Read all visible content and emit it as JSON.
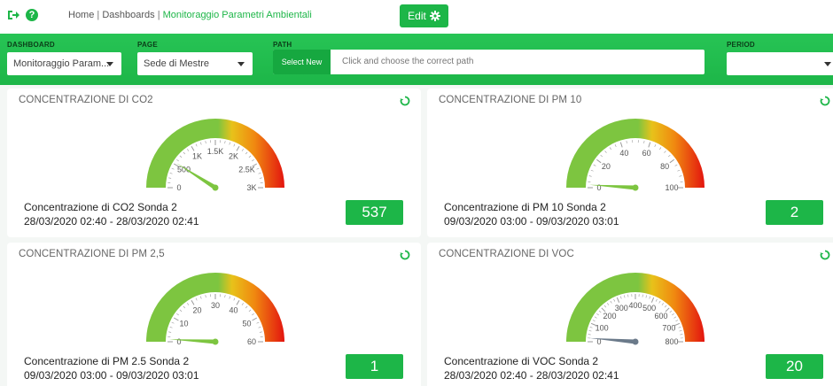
{
  "header": {
    "breadcrumb": {
      "home": "Home",
      "sep1": " | ",
      "dashboards": "Dashboards",
      "sep2": " | ",
      "current": "Monitoraggio Parametri Ambientali"
    },
    "edit_label": "Edit",
    "help_glyph": "?",
    "icons": {
      "logout": "logout-icon",
      "help": "help-icon",
      "gear": "gear-icon"
    }
  },
  "filters": {
    "dashboard": {
      "label": "DASHBOARD",
      "value": "Monitoraggio Param..."
    },
    "page": {
      "label": "PAGE",
      "value": "Sede di Mestre"
    },
    "path": {
      "label": "PATH",
      "button": "Select New",
      "placeholder": "Click and choose the correct path"
    },
    "period": {
      "label": "PERIOD",
      "value": ""
    }
  },
  "colors": {
    "accent": "#1db648",
    "gauge_green": "#7dc540",
    "gauge_yellow": "#f5b400",
    "gauge_red": "#e3140f"
  },
  "cards": [
    {
      "title": "CONCENTRAZIONE DI CO2",
      "desc_line1": "Concentrazione di CO2 Sonda 2",
      "desc_line2": "28/03/2020 02:40 - 28/03/2020 02:41",
      "value": "537",
      "min": 0,
      "max": 3000,
      "reading": 537,
      "ticks": [
        0,
        500,
        1000,
        1500,
        2000,
        2500,
        3000
      ],
      "tick_labels": [
        "0",
        "500",
        "1K",
        "1.5K",
        "2K",
        "2.5K",
        "3K"
      ],
      "needle_color": "#7dc540"
    },
    {
      "title": "CONCENTRAZIONE DI PM 10",
      "desc_line1": "Concentrazione di PM 10 Sonda 2",
      "desc_line2": "09/03/2020 03:00 - 09/03/2020 03:01",
      "value": "2",
      "min": 0,
      "max": 100,
      "reading": 2,
      "ticks": [
        0,
        20,
        40,
        60,
        80,
        100
      ],
      "tick_labels": [
        "0",
        "20",
        "40",
        "60",
        "80",
        "100"
      ],
      "needle_color": "#7dc540"
    },
    {
      "title": "CONCENTRAZIONE DI PM 2,5",
      "desc_line1": "Concentrazione di PM 2.5 Sonda 2",
      "desc_line2": "09/03/2020 03:00 - 09/03/2020 03:01",
      "value": "1",
      "min": 0,
      "max": 60,
      "reading": 1,
      "ticks": [
        0,
        10,
        20,
        30,
        40,
        50,
        60
      ],
      "tick_labels": [
        "0",
        "10",
        "20",
        "30",
        "40",
        "50",
        "60"
      ],
      "needle_color": "#7dc540"
    },
    {
      "title": "CONCENTRAZIONE DI VOC",
      "desc_line1": "Concentrazione di VOC Sonda 2",
      "desc_line2": "28/03/2020 02:40 - 28/03/2020 02:41",
      "value": "20",
      "min": 0,
      "max": 800,
      "reading": 20,
      "ticks": [
        0,
        100,
        200,
        300,
        400,
        500,
        600,
        700,
        800
      ],
      "tick_labels": [
        "0",
        "100",
        "200",
        "300",
        "400",
        "500",
        "600",
        "700",
        "800"
      ],
      "needle_color": "#6b7a8a"
    }
  ]
}
